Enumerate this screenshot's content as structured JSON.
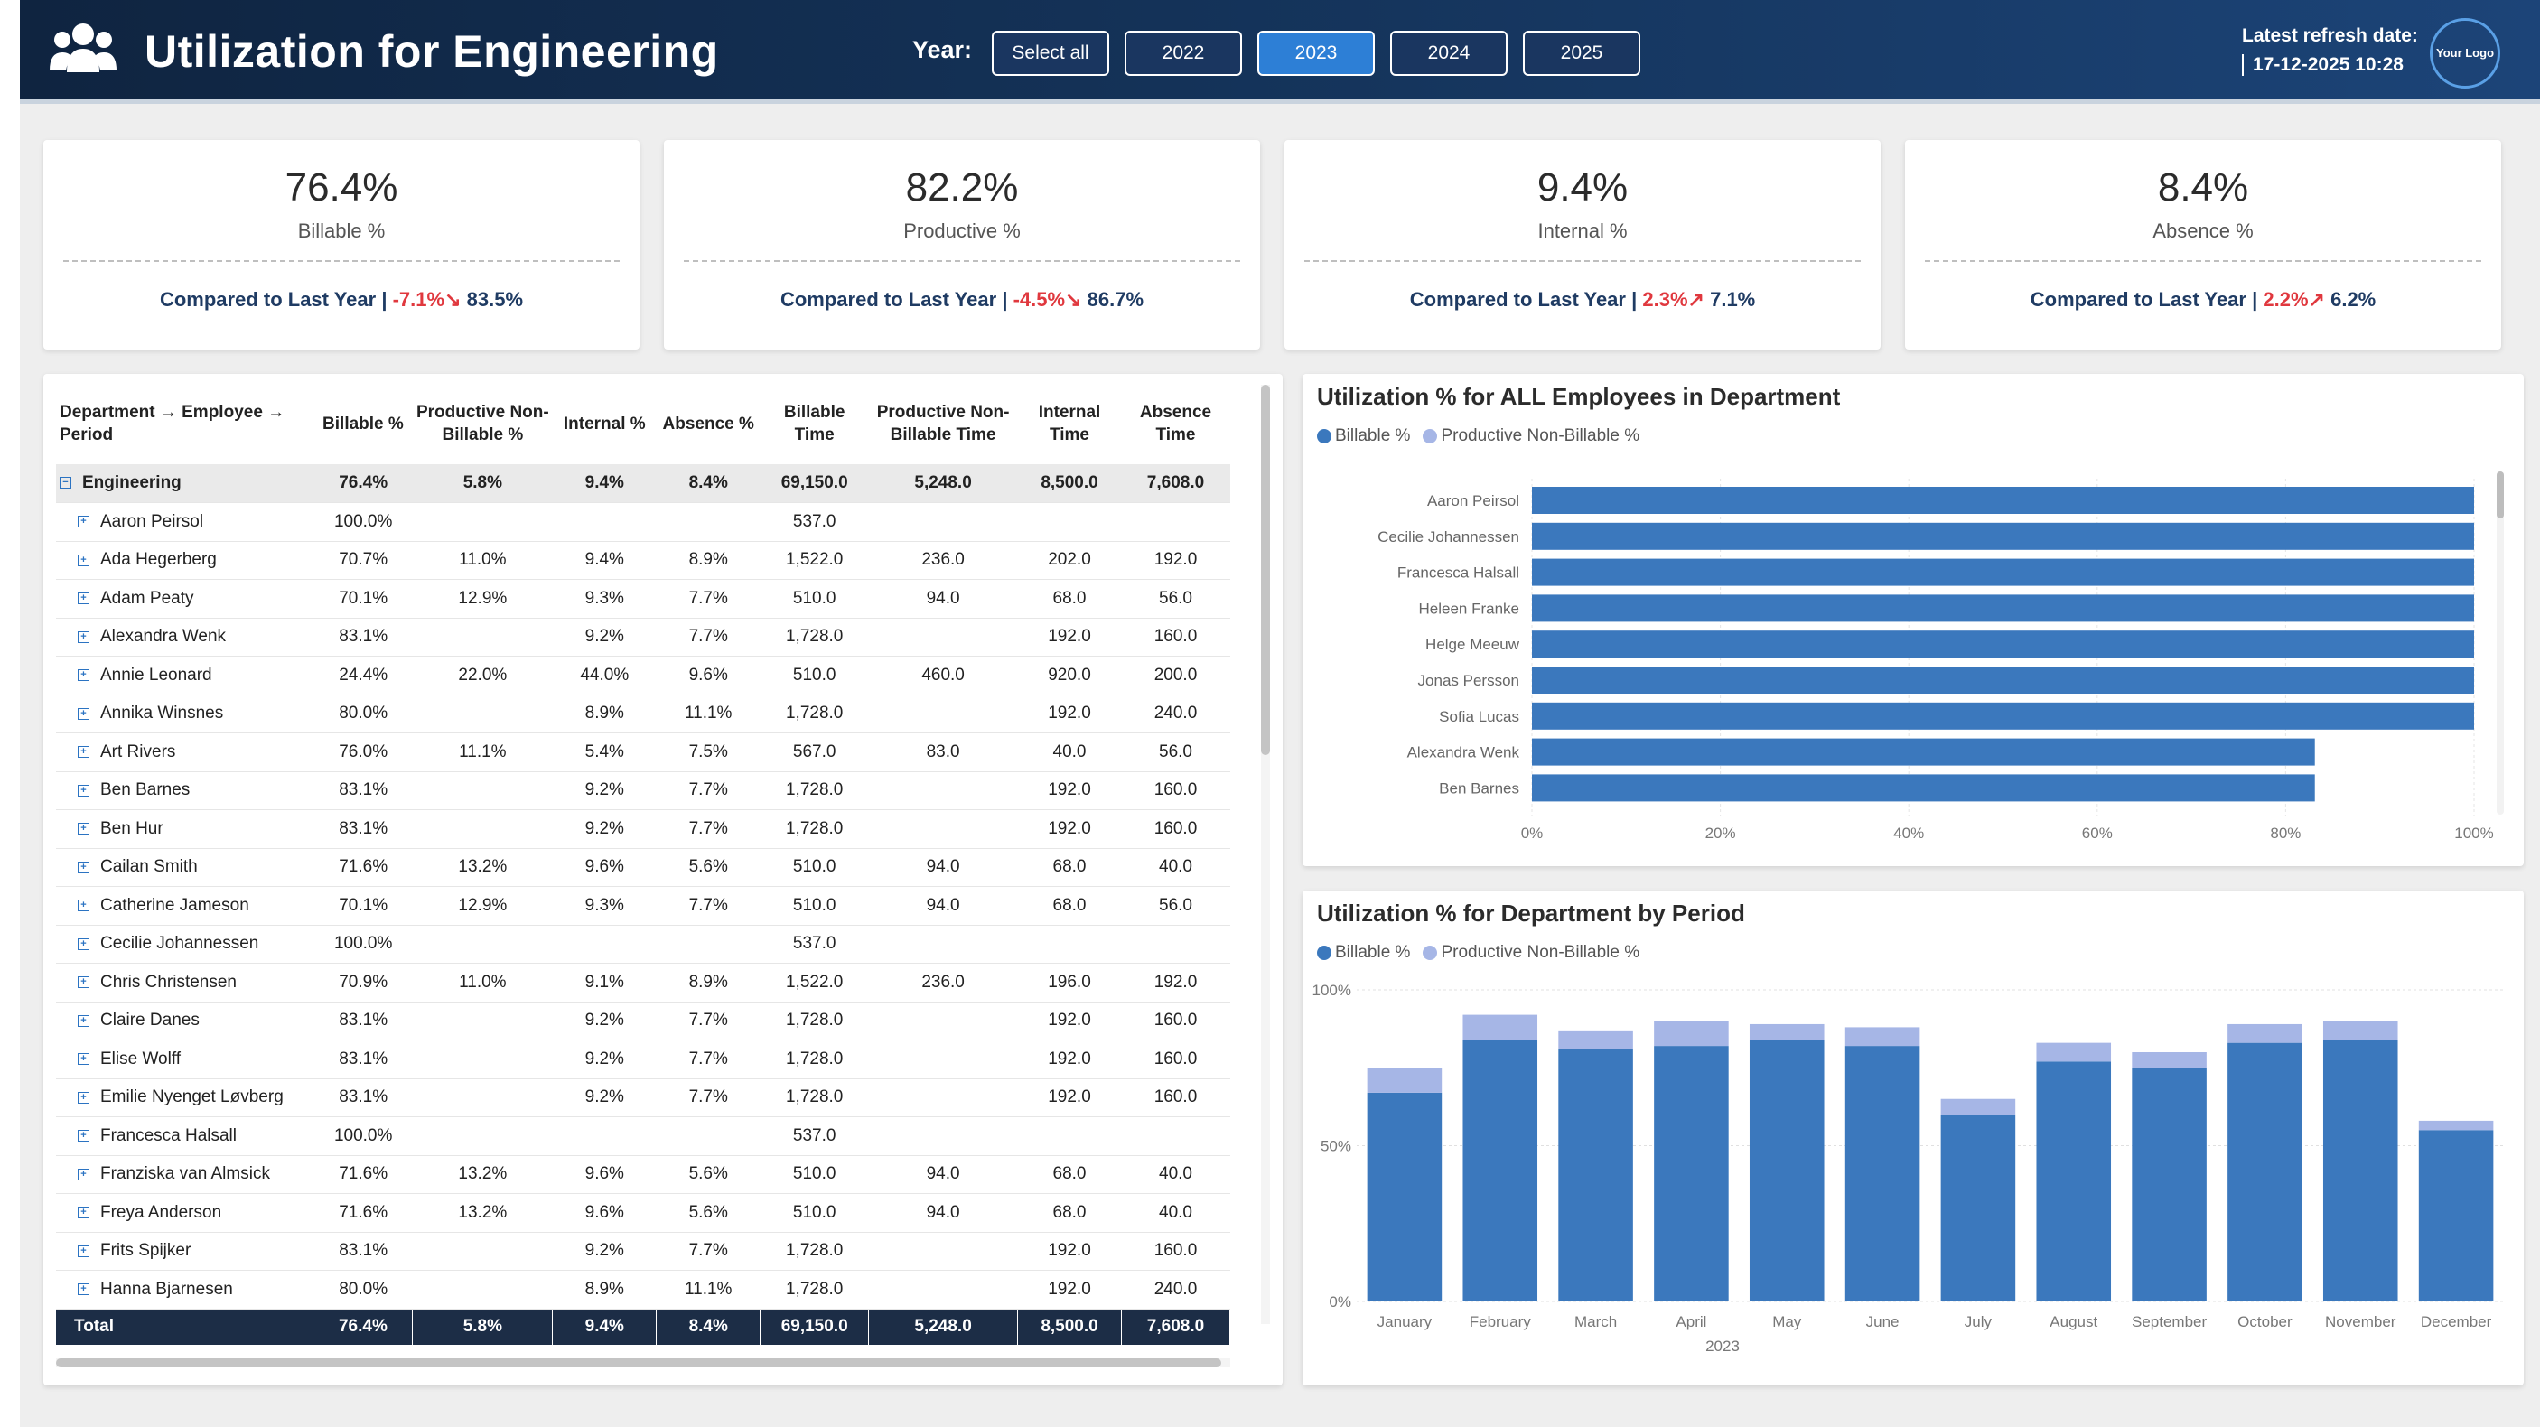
{
  "header": {
    "title": "Utilization for Engineering",
    "year_label": "Year:",
    "year_buttons": [
      "Select all",
      "2022",
      "2023",
      "2024",
      "2025"
    ],
    "selected_year": "2023",
    "refresh_label": "Latest refresh date:",
    "refresh_value": "17-12-2025 10:28",
    "logo_text": "Your Logo"
  },
  "kpis": [
    {
      "value": "76.4%",
      "label": "Billable %",
      "compare_text": "Compared to Last Year",
      "delta": "-7.1%",
      "arrow": "↘",
      "previous": "83.5%"
    },
    {
      "value": "82.2%",
      "label": "Productive %",
      "compare_text": "Compared to Last Year",
      "delta": "-4.5%",
      "arrow": "↘",
      "previous": "86.7%"
    },
    {
      "value": "9.4%",
      "label": "Internal %",
      "compare_text": "Compared to Last Year",
      "delta": "2.3%",
      "arrow": "↗",
      "previous": "7.1%"
    },
    {
      "value": "8.4%",
      "label": "Absence %",
      "compare_text": "Compared to Last Year",
      "delta": "2.2%",
      "arrow": "↗",
      "previous": "6.2%"
    }
  ],
  "matrix": {
    "columns": [
      "Department → Employee → Period",
      "Billable %",
      "Productive Non-Billable %",
      "Internal %",
      "Absence %",
      "Billable Time",
      "Productive Non-Billable Time",
      "Internal Time",
      "Absence Time"
    ],
    "group": [
      "Engineering",
      "76.4%",
      "5.8%",
      "9.4%",
      "8.4%",
      "69,150.0",
      "5,248.0",
      "8,500.0",
      "7,608.0"
    ],
    "rows": [
      [
        "Aaron Peirsol",
        "100.0%",
        "",
        "",
        "",
        "537.0",
        "",
        "",
        ""
      ],
      [
        "Ada Hegerberg",
        "70.7%",
        "11.0%",
        "9.4%",
        "8.9%",
        "1,522.0",
        "236.0",
        "202.0",
        "192.0"
      ],
      [
        "Adam Peaty",
        "70.1%",
        "12.9%",
        "9.3%",
        "7.7%",
        "510.0",
        "94.0",
        "68.0",
        "56.0"
      ],
      [
        "Alexandra Wenk",
        "83.1%",
        "",
        "9.2%",
        "7.7%",
        "1,728.0",
        "",
        "192.0",
        "160.0"
      ],
      [
        "Annie Leonard",
        "24.4%",
        "22.0%",
        "44.0%",
        "9.6%",
        "510.0",
        "460.0",
        "920.0",
        "200.0"
      ],
      [
        "Annika Winsnes",
        "80.0%",
        "",
        "8.9%",
        "11.1%",
        "1,728.0",
        "",
        "192.0",
        "240.0"
      ],
      [
        "Art Rivers",
        "76.0%",
        "11.1%",
        "5.4%",
        "7.5%",
        "567.0",
        "83.0",
        "40.0",
        "56.0"
      ],
      [
        "Ben Barnes",
        "83.1%",
        "",
        "9.2%",
        "7.7%",
        "1,728.0",
        "",
        "192.0",
        "160.0"
      ],
      [
        "Ben Hur",
        "83.1%",
        "",
        "9.2%",
        "7.7%",
        "1,728.0",
        "",
        "192.0",
        "160.0"
      ],
      [
        "Cailan Smith",
        "71.6%",
        "13.2%",
        "9.6%",
        "5.6%",
        "510.0",
        "94.0",
        "68.0",
        "40.0"
      ],
      [
        "Catherine Jameson",
        "70.1%",
        "12.9%",
        "9.3%",
        "7.7%",
        "510.0",
        "94.0",
        "68.0",
        "56.0"
      ],
      [
        "Cecilie Johannessen",
        "100.0%",
        "",
        "",
        "",
        "537.0",
        "",
        "",
        ""
      ],
      [
        "Chris Christensen",
        "70.9%",
        "11.0%",
        "9.1%",
        "8.9%",
        "1,522.0",
        "236.0",
        "196.0",
        "192.0"
      ],
      [
        "Claire Danes",
        "83.1%",
        "",
        "9.2%",
        "7.7%",
        "1,728.0",
        "",
        "192.0",
        "160.0"
      ],
      [
        "Elise Wolff",
        "83.1%",
        "",
        "9.2%",
        "7.7%",
        "1,728.0",
        "",
        "192.0",
        "160.0"
      ],
      [
        "Emilie Nyenget Løvberg",
        "83.1%",
        "",
        "9.2%",
        "7.7%",
        "1,728.0",
        "",
        "192.0",
        "160.0"
      ],
      [
        "Francesca Halsall",
        "100.0%",
        "",
        "",
        "",
        "537.0",
        "",
        "",
        ""
      ],
      [
        "Franziska van Almsick",
        "71.6%",
        "13.2%",
        "9.6%",
        "5.6%",
        "510.0",
        "94.0",
        "68.0",
        "40.0"
      ],
      [
        "Freya Anderson",
        "71.6%",
        "13.2%",
        "9.6%",
        "5.6%",
        "510.0",
        "94.0",
        "68.0",
        "40.0"
      ],
      [
        "Frits Spijker",
        "83.1%",
        "",
        "9.2%",
        "7.7%",
        "1,728.0",
        "",
        "192.0",
        "160.0"
      ],
      [
        "Hanna Bjarnesen",
        "80.0%",
        "",
        "8.9%",
        "11.1%",
        "1,728.0",
        "",
        "192.0",
        "240.0"
      ]
    ],
    "total": [
      "Total",
      "76.4%",
      "5.8%",
      "9.4%",
      "8.4%",
      "69,150.0",
      "5,248.0",
      "8,500.0",
      "7,608.0"
    ]
  },
  "employee_chart": {
    "title": "Utilization % for ALL Employees in Department",
    "legend": [
      "Billable %",
      "Productive Non-Billable %"
    ]
  },
  "period_chart": {
    "title": "Utilization % for Department by Period",
    "legend": [
      "Billable %",
      "Productive Non-Billable %"
    ],
    "year_axis_label": "2023"
  },
  "colors": {
    "billable": "#3b78bd",
    "productive_nb": "#a6b6e6",
    "negative_delta": "#e0383e",
    "header_dark": "#0f2440",
    "selected_year": "#2d7fd6"
  },
  "chart_data": [
    {
      "type": "bar",
      "orientation": "horizontal",
      "title": "Utilization % for ALL Employees in Department",
      "categories": [
        "Aaron Peirsol",
        "Cecilie Johannessen",
        "Francesca Halsall",
        "Heleen Franke",
        "Helge Meeuw",
        "Jonas Persson",
        "Sofia Lucas",
        "Alexandra Wenk",
        "Ben Barnes"
      ],
      "series": [
        {
          "name": "Billable %",
          "values": [
            100.0,
            100.0,
            100.0,
            100.0,
            100.0,
            100.0,
            100.0,
            83.1,
            83.1
          ]
        },
        {
          "name": "Productive Non-Billable %",
          "values": [
            0,
            0,
            0,
            0,
            0,
            0,
            0,
            0,
            0
          ]
        }
      ],
      "xlim": [
        0,
        100
      ],
      "x_ticks": [
        "0%",
        "20%",
        "40%",
        "60%",
        "80%",
        "100%"
      ],
      "grid": true,
      "legend_position": "top-left"
    },
    {
      "type": "bar",
      "stacked": true,
      "title": "Utilization % for Department by Period",
      "categories": [
        "January",
        "February",
        "March",
        "April",
        "May",
        "June",
        "July",
        "August",
        "September",
        "October",
        "November",
        "December"
      ],
      "series": [
        {
          "name": "Billable %",
          "values": [
            67,
            84,
            81,
            82,
            84,
            82,
            60,
            77,
            75,
            83,
            84,
            55
          ]
        },
        {
          "name": "Productive Non-Billable %",
          "values": [
            8,
            8,
            6,
            8,
            5,
            6,
            5,
            6,
            5,
            6,
            6,
            3
          ]
        }
      ],
      "ylim": [
        0,
        100
      ],
      "y_ticks": [
        "0%",
        "50%",
        "100%"
      ],
      "xlabel": "2023",
      "grid": true,
      "legend_position": "top-left"
    }
  ]
}
